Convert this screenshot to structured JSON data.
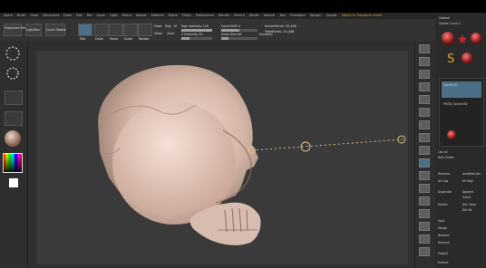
{
  "menubar": {
    "items": [
      "Alpha",
      "Brush",
      "Color",
      "Document",
      "Draw",
      "Edit",
      "File",
      "Layer",
      "Light",
      "Macro",
      "Marker",
      "Material",
      "Movie",
      "Picker",
      "Preferences",
      "Render",
      "Stencil",
      "Stroke",
      "Texture",
      "Tool",
      "Transform",
      "Zplugin",
      "Zscript"
    ],
    "hint": "Switch to Transform mode"
  },
  "toolbar": {
    "projection_label": "Projection Master",
    "lightbox_label": "LightBox",
    "quick_sketch_label": "Quick Sketch",
    "edit_label": "Edit",
    "draw_label": "Draw",
    "move_label": "Move",
    "scale_label": "Scale",
    "rotate_label": "Rotate",
    "mrgb_label": "Mrgb",
    "rgb_label": "Rgb",
    "m_label": "M",
    "zadd_label": "Zadd",
    "zsub_label": "Zsub",
    "focal_label": "Focal Shift 0",
    "draw_size_label": "Draw Size 64",
    "active_points_label": "ActivePoints: 20,448",
    "total_points_label": "TotalPoints: 20,448",
    "rgb_intensity_label": "Rgb Intensity 100",
    "z_intensity_label": "Z Intensity 25",
    "dynamic_label": "Dynamic"
  },
  "rightpanel": {
    "title": "Subtool",
    "visible_count_label": "Visible Count 1",
    "list_label": "List All",
    "new_folder_label": "New Folder",
    "rename_label": "Rename",
    "auto_reorder_label": "AutoReorder",
    "all_low_label": "All Low",
    "all_high_label": "All High",
    "duplicate_label": "Duplicate",
    "append_label": "Append",
    "insert_label": "Insert",
    "delete_label": "Delete",
    "del_other_label": "Del Other",
    "del_all_label": "Del All",
    "split_label": "Split",
    "merge_label": "Merge",
    "boolean_label": "Boolean",
    "remesh_label": "Remesh",
    "project_label": "Project",
    "extract_label": "Extract",
    "subtool_items": [
      "Sphere3D",
      "PM3D_Sphere3D"
    ]
  },
  "canvas": {
    "skull_color": "#d9bfb2",
    "background_color": "#3a3a3a"
  },
  "colors": {
    "accent": "#e0a030",
    "active_button": "#4a6f86",
    "material_red": "#b8282a"
  }
}
